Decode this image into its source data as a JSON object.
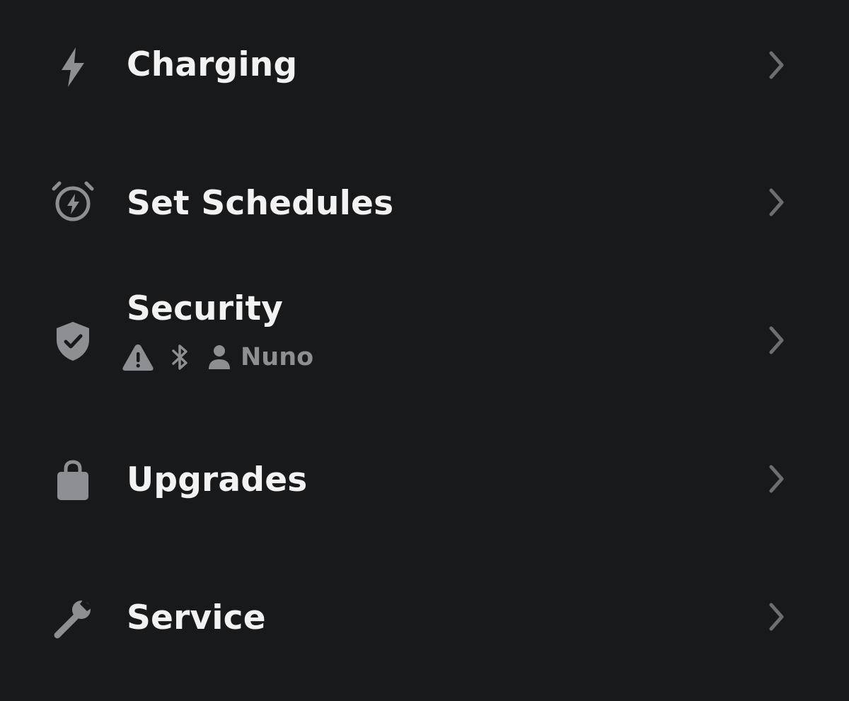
{
  "colors": {
    "background": "#18191b",
    "label": "#f2f2f3",
    "icon": "#8e8f92",
    "chevron": "#6d6e71"
  },
  "menu": {
    "items": [
      {
        "label": "Charging",
        "icon": "lightning-bolt-icon"
      },
      {
        "label": "Set Schedules",
        "icon": "alarm-clock-bolt-icon"
      },
      {
        "label": "Security",
        "icon": "shield-check-icon",
        "status": {
          "icons": [
            "warning-triangle-icon",
            "bluetooth-icon",
            "person-icon"
          ],
          "user": "Nuno"
        }
      },
      {
        "label": "Upgrades",
        "icon": "shopping-bag-icon"
      },
      {
        "label": "Service",
        "icon": "wrench-icon"
      }
    ]
  }
}
